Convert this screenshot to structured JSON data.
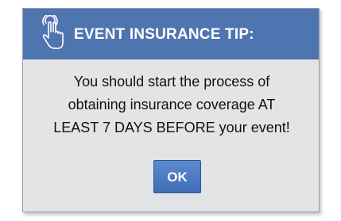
{
  "dialog": {
    "title": "EVENT INSURANCE TIP:",
    "icon": "pointing-hand-icon",
    "message_lines": [
      "You should start the process of",
      "obtaining insurance coverage AT",
      "LEAST 7 DAYS BEFORE your event!"
    ],
    "ok_label": "OK"
  },
  "colors": {
    "header": "#4f75b1",
    "body": "#e3e4e6",
    "button": "#3f6db7"
  }
}
